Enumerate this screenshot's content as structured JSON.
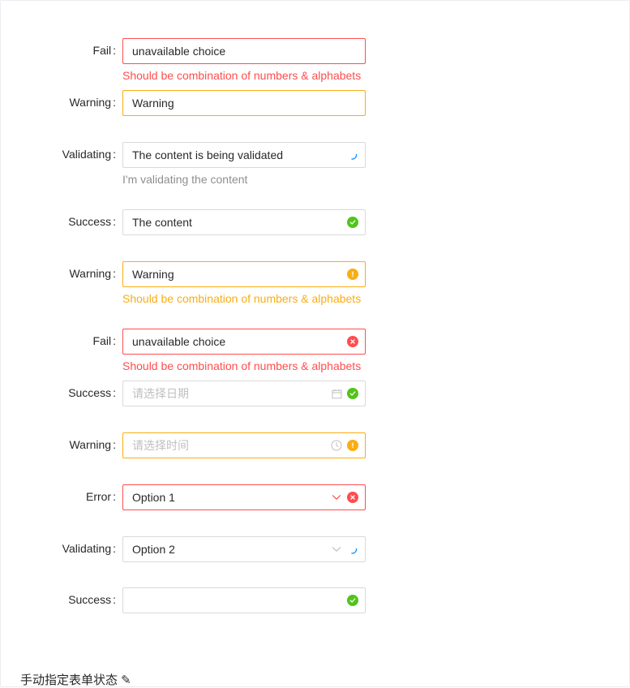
{
  "form": {
    "colon": ":",
    "items": [
      {
        "label": "Fail",
        "value": "unavailable choice",
        "help": "Should be combination of numbers & alphabets"
      },
      {
        "label": "Warning",
        "value": "Warning"
      },
      {
        "label": "Validating",
        "value": "The content is being validated",
        "help": "I'm validating the content"
      },
      {
        "label": "Success",
        "value": "The content"
      },
      {
        "label": "Warning",
        "value": "Warning",
        "help": "Should be combination of numbers & alphabets"
      },
      {
        "label": "Fail",
        "value": "unavailable choice",
        "help": "Should be combination of numbers & alphabets"
      },
      {
        "label": "Success",
        "placeholder": "请选择日期"
      },
      {
        "label": "Warning",
        "placeholder": "请选择时间"
      },
      {
        "label": "Error",
        "value": "Option 1"
      },
      {
        "label": "Validating",
        "value": "Option 2"
      },
      {
        "label": "Success",
        "value": ""
      }
    ]
  },
  "footer": {
    "text": "手动指定表单状态 ✎"
  },
  "colors": {
    "error": "#ff4d4f",
    "warning": "#faad14",
    "success": "#52c41a",
    "validating": "#1890ff"
  }
}
